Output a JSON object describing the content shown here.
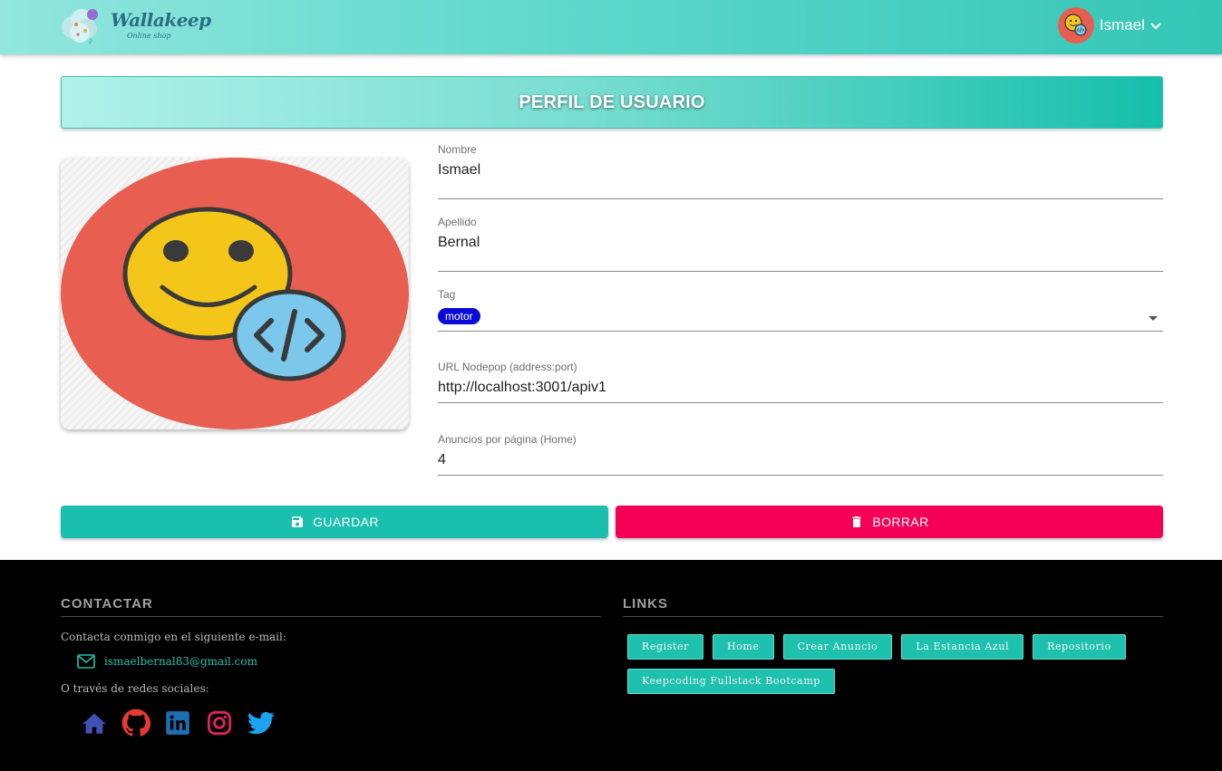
{
  "header": {
    "logo_text": "Wallakeep",
    "logo_subtitle": "Online shop",
    "user_name": "Ismael"
  },
  "page": {
    "title": "PERFIL DE USUARIO"
  },
  "form": {
    "nombre": {
      "label": "Nombre",
      "value": "Ismael"
    },
    "apellido": {
      "label": "Apellido",
      "value": "Bernal"
    },
    "tag": {
      "label": "Tag",
      "value": "motor"
    },
    "url": {
      "label": "URL Nodepop (address:port)",
      "value": "http://localhost:3001/apiv1"
    },
    "anuncios": {
      "label": "Anuncios por página (Home)",
      "value": "4"
    }
  },
  "actions": {
    "save_label": "GUARDAR",
    "delete_label": "BORRAR"
  },
  "footer": {
    "contact_heading": "CONTACTAR",
    "contact_text": "Contacta conmigo en el siguiente e-mail:",
    "email": "ismaelbernal83@gmail.com",
    "social_text": "O través de redes sociales:",
    "social_icons": [
      "home-icon",
      "github-icon",
      "linkedin-icon",
      "instagram-icon",
      "twitter-icon"
    ],
    "links_heading": "LINKS",
    "links": [
      "Register",
      "Home",
      "Crear Anuncio",
      "La Estancia Azul",
      "Repositorio",
      "Keepcoding Fullstack Bootcamp"
    ]
  },
  "colors": {
    "accent": "#1abfae",
    "danger": "#f50057",
    "tag_chip": "#0a0ad8",
    "avatar_bg": "#e85e50"
  }
}
